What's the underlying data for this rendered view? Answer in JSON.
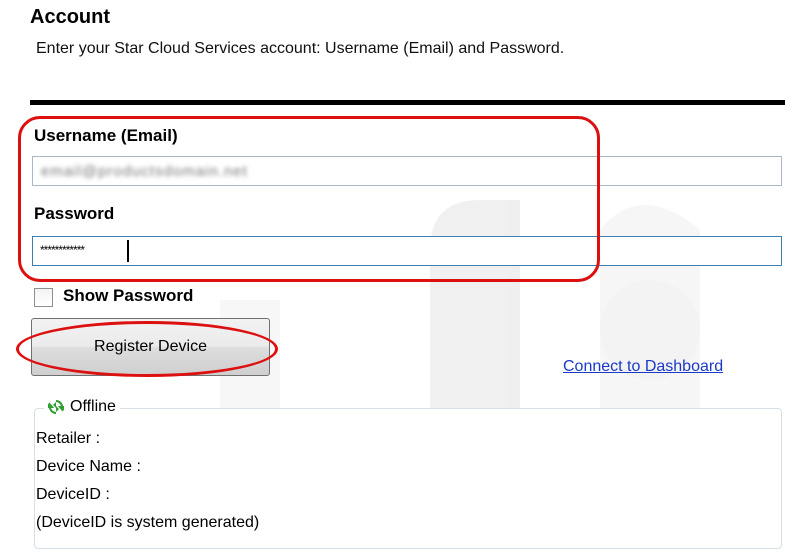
{
  "account": {
    "title": "Account",
    "description": "Enter your Star Cloud Services account: Username (Email) and Password."
  },
  "username": {
    "label": "Username (Email)",
    "value": "email@productsdomain.net"
  },
  "password": {
    "label": "Password",
    "value": "************"
  },
  "show_password": {
    "label": "Show Password",
    "checked": false
  },
  "register_button": {
    "label": "Register Device"
  },
  "dashboard_link": {
    "label": "Connect to Dashboard"
  },
  "status": {
    "legend": "Offline",
    "icon": "refresh-icon",
    "retailer_label": "Retailer :",
    "device_name_label": "Device Name :",
    "device_id_label": "DeviceID :",
    "device_id_note": "(DeviceID is system generated)"
  },
  "colors": {
    "highlight": "#dd1010",
    "link": "#1a39c9",
    "status_icon": "#2e9e2e"
  }
}
